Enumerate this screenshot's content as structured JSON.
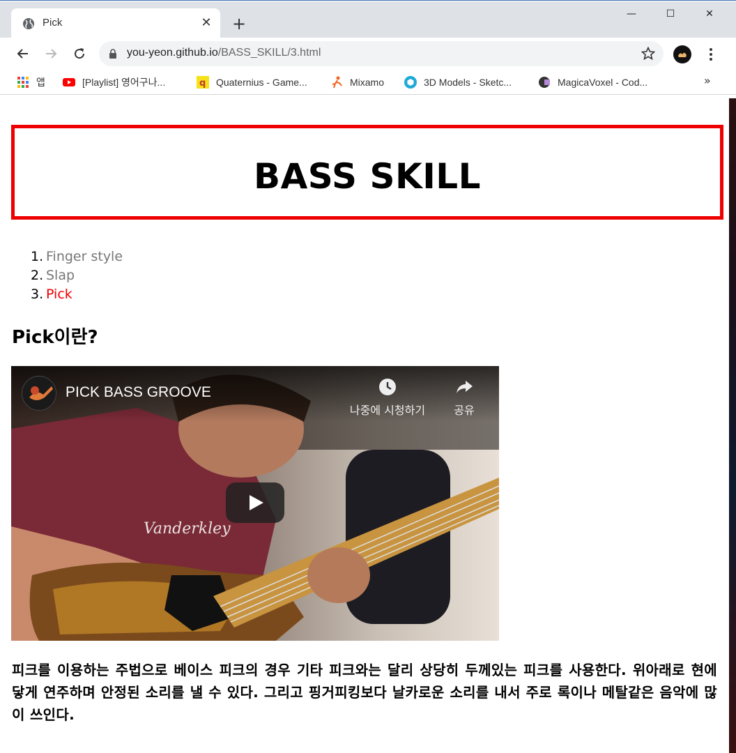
{
  "browser": {
    "tab_title": "Pick",
    "tab_close_glyph": "✕",
    "new_tab_glyph": "+",
    "url_host": "you-yeon.github.io",
    "url_path": "/BASS_SKILL/3.html",
    "window_controls": {
      "minimize": "—",
      "maximize": "☐",
      "close": "✕"
    },
    "bookmarks": [
      {
        "label": "앱",
        "icon": "apps-grid-icon"
      },
      {
        "label": "[Playlist] 영어구나...",
        "icon": "youtube-icon"
      },
      {
        "label": "Quaternius - Game...",
        "icon": "quaternius-icon"
      },
      {
        "label": "Mixamo",
        "icon": "mixamo-icon"
      },
      {
        "label": "3D Models - Sketc...",
        "icon": "sketchfab-icon"
      },
      {
        "label": "MagicaVoxel - Cod...",
        "icon": "magicavoxel-icon"
      }
    ],
    "bookmarks_more": "»"
  },
  "page": {
    "heading": "BASS SKILL",
    "skills": [
      {
        "num": "1.",
        "label": "Finger style",
        "active": false
      },
      {
        "num": "2.",
        "label": "Slap",
        "active": false
      },
      {
        "num": "3.",
        "label": "Pick",
        "active": true
      }
    ],
    "section_title": "Pick이란?",
    "video": {
      "title": "PICK BASS GROOVE",
      "watch_later": "나중에 시청하기",
      "share": "공유"
    },
    "description": "피크를 이용하는 주법으로 베이스 피크의 경우 기타 피크와는 달리 상당히 두께있는 피크를 사용한다. 위아래로 현에 닿게 연주하며 안정된 소리를 낼 수 있다. 그리고 핑거피킹보다 날카로운 소리를 내서 주로 록이나 메탈같은 음악에 많이 쓰인다."
  },
  "colors": {
    "accent_red": "#ee0000",
    "link_gray": "#777777"
  }
}
